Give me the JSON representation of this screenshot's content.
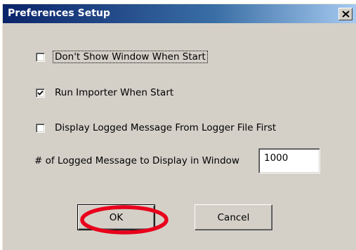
{
  "dialog": {
    "title": "Preferences Setup",
    "close_label": "close"
  },
  "options": {
    "dont_show_window": {
      "label": "Don't Show Window When Start",
      "checked": false
    },
    "run_importer": {
      "label": "Run Importer When Start",
      "checked": true
    },
    "display_logged_first": {
      "label": "Display Logged Message From Logger File First",
      "checked": false
    }
  },
  "message_count": {
    "label": "# of Logged Message to Display in Window",
    "value": "1000"
  },
  "buttons": {
    "ok_label": "OK",
    "cancel_label": "Cancel"
  },
  "annotation": {
    "color": "#e8001c"
  }
}
